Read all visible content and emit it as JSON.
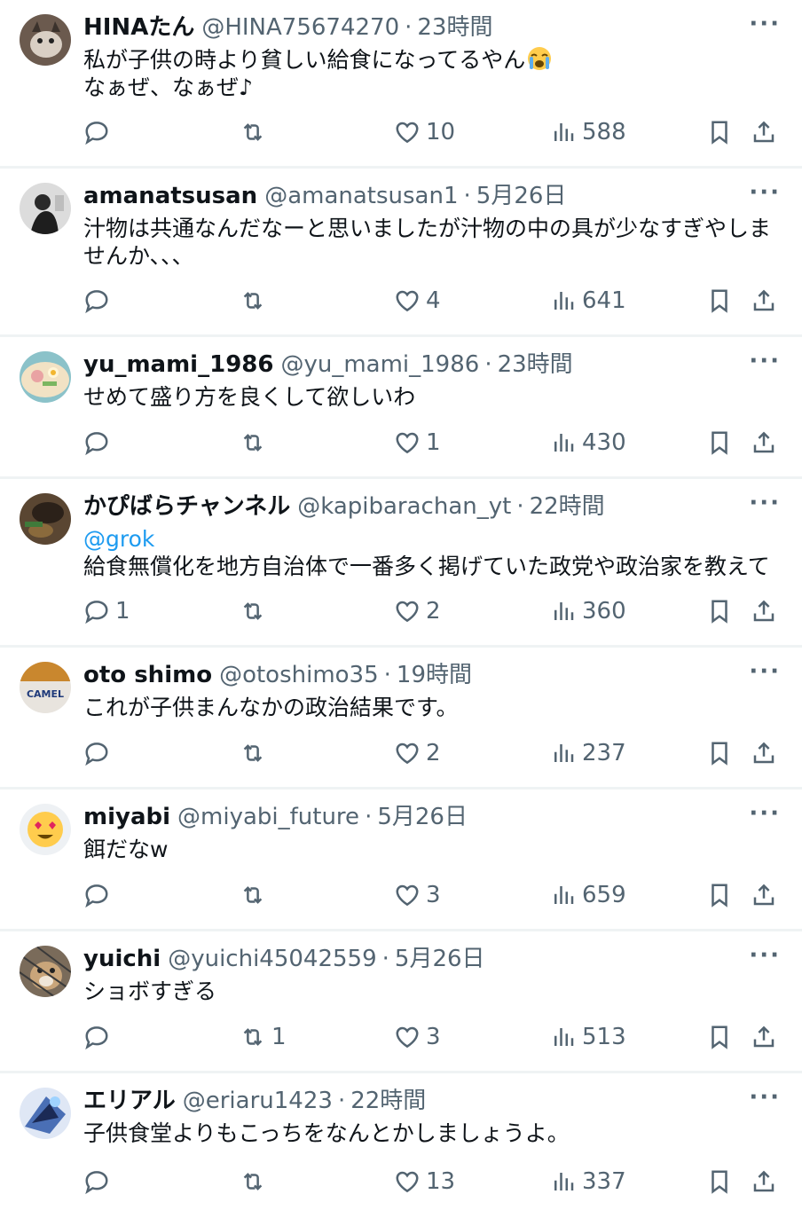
{
  "posts": [
    {
      "name": "HINAたん",
      "handle": "@HINA75674270",
      "time": "23時間",
      "text": [
        "私が子供の時より貧しい給食になってるやん",
        "なぁぜ、なぁぜ♪"
      ],
      "emoji": "loudly-crying-face",
      "replies": "",
      "retweets": "",
      "likes": "10",
      "views": "588",
      "avatar_color": "#6b5a4e"
    },
    {
      "name": "amanatsusan",
      "handle": "@amanatsusan1",
      "time": "5月26日",
      "text": [
        "汁物は共通なんだなーと思いましたが汁物の中の具が少なすぎやしま",
        "せんか、、、"
      ],
      "replies": "",
      "retweets": "",
      "likes": "4",
      "views": "641",
      "avatar_color": "#d8d8d8"
    },
    {
      "name": "yu_mami_1986",
      "handle": "@yu_mami_1986",
      "time": "23時間",
      "text": [
        "せめて盛り方を良くして欲しいわ"
      ],
      "replies": "",
      "retweets": "",
      "likes": "1",
      "views": "430",
      "avatar_color": "#e9c9a0"
    },
    {
      "name": "かぴばらチャンネル",
      "handle": "@kapibarachan_yt",
      "time": "22時間",
      "mention": "@grok",
      "text": [
        "給食無償化を地方自治体で一番多く掲げていた政党や政治家を教えて"
      ],
      "replies": "1",
      "retweets": "",
      "likes": "2",
      "views": "360",
      "avatar_color": "#5a4632"
    },
    {
      "name": "oto shimo",
      "handle": "@otoshimo35",
      "time": "19時間",
      "text": [
        "これが子供まんなかの政治結果です。"
      ],
      "replies": "",
      "retweets": "",
      "likes": "2",
      "views": "237",
      "avatar_color": "#e8e4de",
      "avatar_text": "CAMEL"
    },
    {
      "name": "miyabi",
      "handle": "@miyabi_future",
      "time": "5月26日",
      "text": [
        "餌だなw"
      ],
      "replies": "",
      "retweets": "",
      "likes": "3",
      "views": "659",
      "avatar_color": "#eef1f4"
    },
    {
      "name": "yuichi",
      "handle": "@yuichi45042559",
      "time": "5月26日",
      "text": [
        "ショボすぎる"
      ],
      "replies": "",
      "retweets": "1",
      "likes": "3",
      "views": "513",
      "avatar_color": "#7a6b5a"
    },
    {
      "name": "エリアル",
      "handle": "@eriaru1423",
      "time": "22時間",
      "text": [
        "子供食堂よりもこっちをなんとかしましょうよ。"
      ],
      "replies": "",
      "retweets": "",
      "likes": "13",
      "views": "337",
      "avatar_color": "#4a6fb5"
    }
  ],
  "more_label": "···",
  "colors": {
    "text": "#0f1419",
    "secondary": "#536471",
    "link": "#1d9bf0",
    "divider": "#eff3f4"
  },
  "icons": [
    "reply-icon",
    "retweet-icon",
    "like-icon",
    "views-icon",
    "bookmark-icon",
    "share-icon",
    "more-icon"
  ]
}
